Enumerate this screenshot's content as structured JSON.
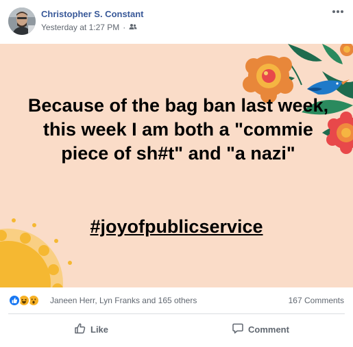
{
  "post": {
    "author": "Christopher S. Constant",
    "timestamp": "Yesterday at 1:27 PM",
    "separator": "·",
    "audience_icon": "friends-icon",
    "more_icon": "more-options-icon",
    "text": "Because of the bag ban last week, this week I am both a \"commie piece of sh#t\" and \"a nazi\"",
    "hashtag": "#joyofpublicservice",
    "background_color": "#fadcc8"
  },
  "reactions": {
    "icons": [
      "like-reaction-icon",
      "haha-reaction-icon",
      "wow-reaction-icon"
    ],
    "reactors_text": "Janeen Herr, Lyn Franks and 165 others",
    "comments_text": "167 Comments"
  },
  "actions": {
    "like_label": "Like",
    "comment_label": "Comment"
  },
  "colors": {
    "author_link": "#385898",
    "muted_text": "#606770",
    "like_blue": "#1877f2",
    "reaction_yellow": "#f7b125"
  }
}
